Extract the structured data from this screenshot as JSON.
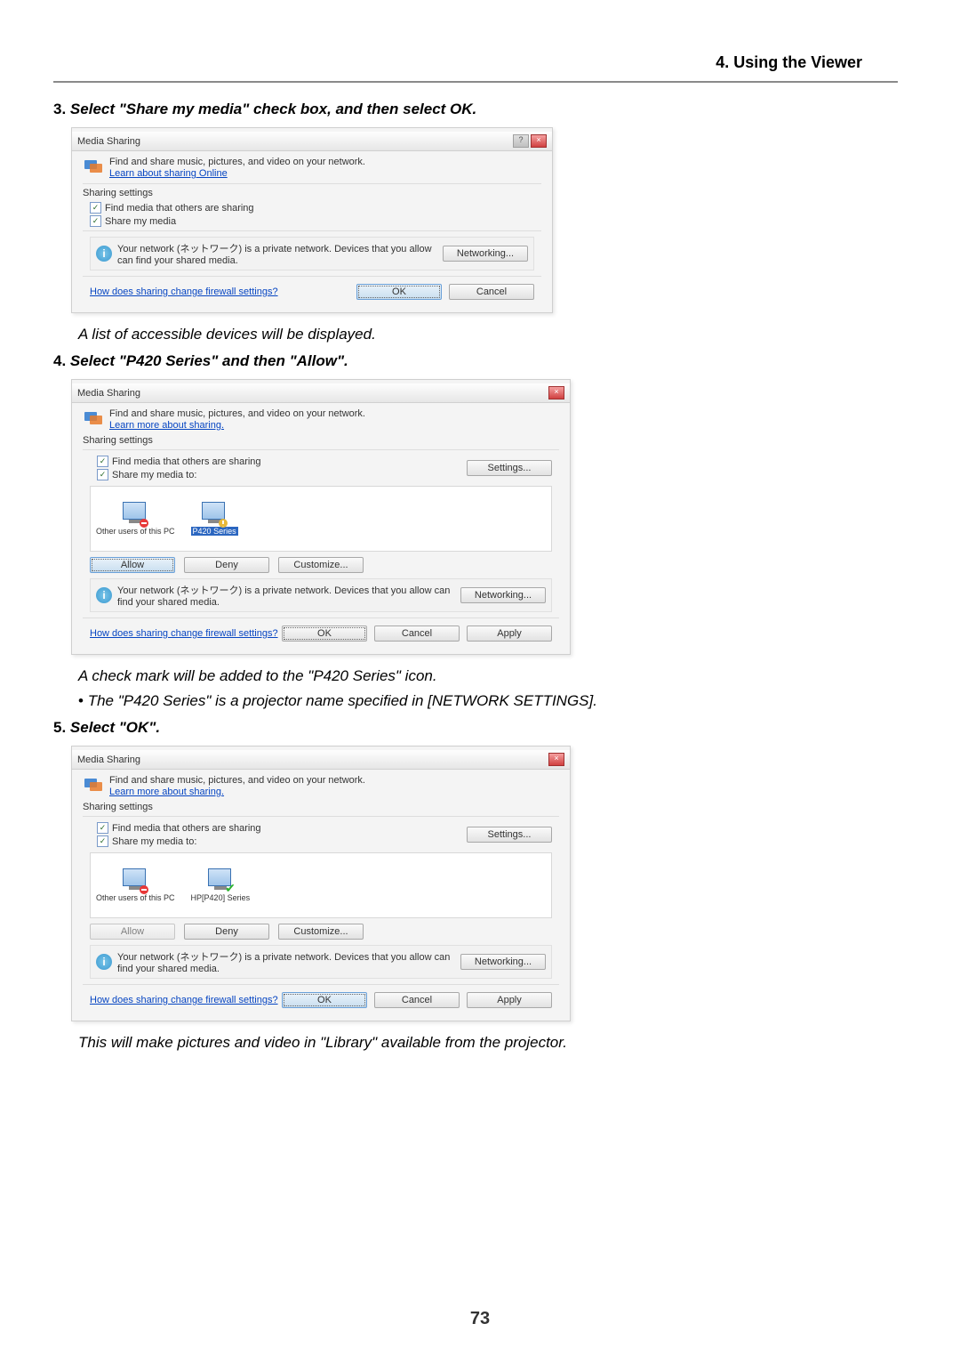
{
  "header": {
    "title": "4. Using the Viewer"
  },
  "steps": {
    "s3": "Select \"Share my media\" check box, and then select OK.",
    "s3_num": "3.",
    "s3_result": "A list of accessible devices will be displayed.",
    "s4": "Select \"P420 Series\" and then \"Allow\".",
    "s4_num": "4.",
    "s4_result": "A check mark will be added to the \"P420 Series\" icon.",
    "s4_bullet": "The \"P420 Series\" is a projector name specified in [NETWORK SETTINGS].",
    "s5": "Select \"OK\".",
    "s5_num": "5.",
    "s5_result": "This will make pictures and video in \"Library\" available from the projector."
  },
  "dialog": {
    "title": "Media Sharing",
    "share_text": "Find and share music, pictures, and video on your network.",
    "learn_link": "Learn about sharing Online",
    "learn_link2": "Learn more about sharing.",
    "sharing_settings": "Sharing settings",
    "cb1": "Find media that others are sharing",
    "cb2": "Share my media",
    "cb2b": "Share my media to:",
    "info_text": "Your network (ネットワーク) is a private network. Devices that you allow can find your shared media.",
    "settings_btn": "Settings...",
    "networking_btn": "Networking...",
    "firewall_link": "How does sharing change firewall settings?",
    "ok_btn": "OK",
    "cancel_btn": "Cancel",
    "apply_btn": "Apply",
    "allow_btn": "Allow",
    "deny_btn": "Deny",
    "customize_btn": "Customize...",
    "device_this": "Other users of this PC",
    "device_p420_sel": "P420 Series",
    "device_p420_full": "HP[P420] Series"
  },
  "page_number": "73"
}
